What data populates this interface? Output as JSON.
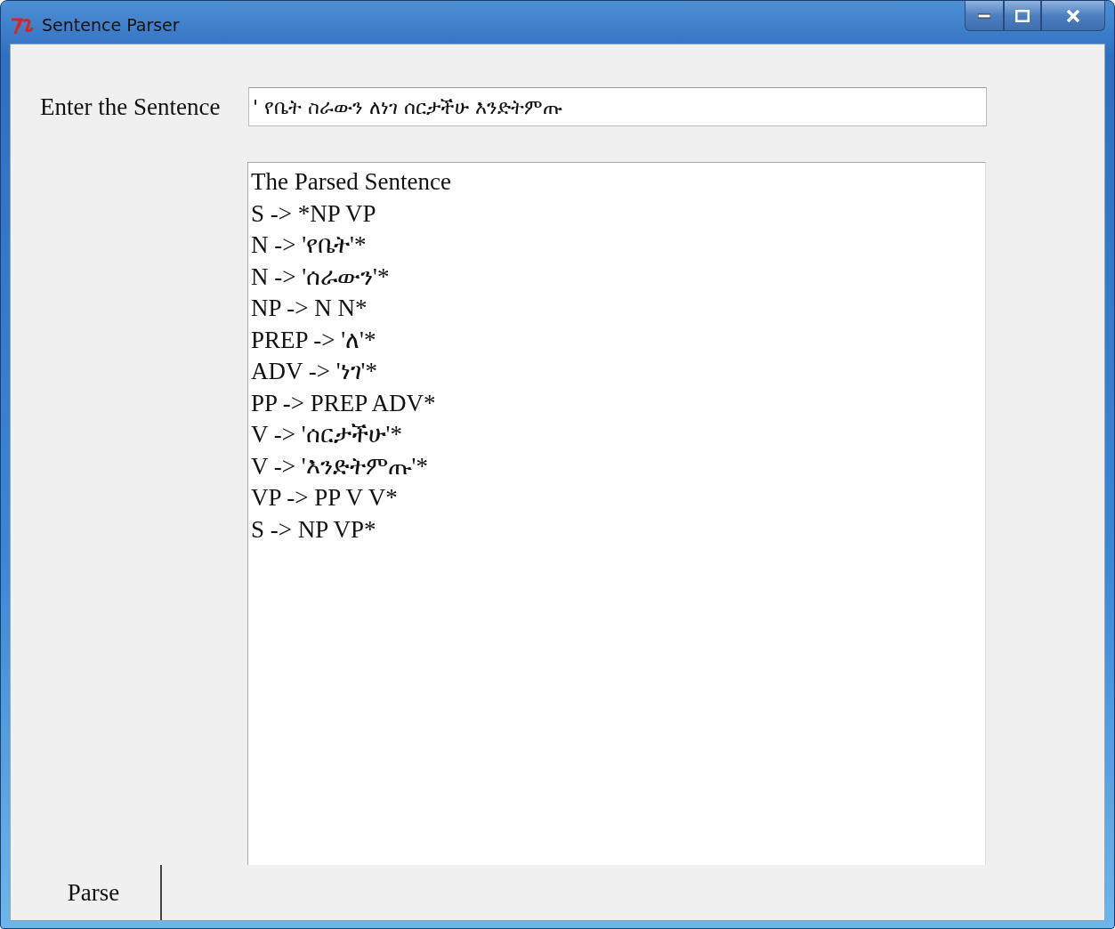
{
  "window": {
    "title": "Sentence Parser"
  },
  "sentence_field": {
    "label": "Enter the Sentence",
    "value": "' የቤት ስራውን ለነገ ሰርታችሁ እንድትምጡ"
  },
  "output": {
    "lines": [
      "The Parsed Sentence",
      "S -> *NP VP",
      "N -> 'የቤት'*",
      "N -> 'ሰራውን'*",
      "NP -> N N*",
      "PREP -> 'ለ'*",
      "ADV -> 'ነገ'*",
      "PP -> PREP ADV*",
      "V -> 'ሰርታችሁ'*",
      "V -> 'እንድትምጡ'*",
      "VP -> PP V V*",
      "S -> NP VP*"
    ]
  },
  "buttons": [
    {
      "label": "Parse"
    }
  ]
}
